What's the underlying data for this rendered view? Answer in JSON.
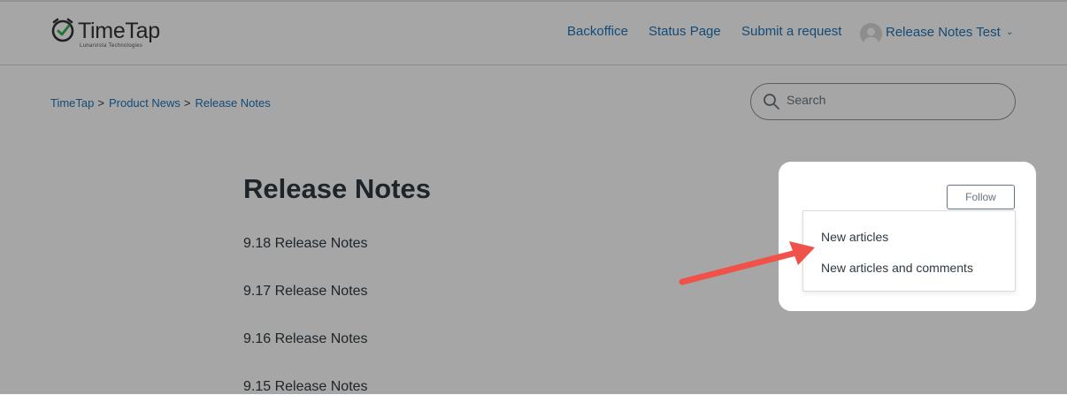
{
  "header": {
    "logo_text": "TimeTap",
    "logo_subtext": "Lunarvista Technologies",
    "nav": [
      {
        "label": "Backoffice"
      },
      {
        "label": "Status Page"
      },
      {
        "label": "Submit a request"
      }
    ],
    "user_name": "Release Notes Test",
    "caret": "⌄"
  },
  "breadcrumb": [
    {
      "label": "TimeTap"
    },
    {
      "label": "Product News"
    },
    {
      "label": "Release Notes"
    }
  ],
  "breadcrumb_separator": ">",
  "search": {
    "placeholder": "Search"
  },
  "section": {
    "title": "Release Notes",
    "articles": [
      {
        "label": "9.18 Release Notes"
      },
      {
        "label": "9.17 Release Notes"
      },
      {
        "label": "9.16 Release Notes"
      },
      {
        "label": "9.15 Release Notes"
      }
    ]
  },
  "follow": {
    "button_label": "Follow",
    "menu": [
      {
        "label": "New articles"
      },
      {
        "label": "New articles and comments"
      }
    ]
  },
  "colors": {
    "link": "#1f73b7",
    "text": "#2f3941",
    "annotation_arrow": "#f0524a"
  },
  "icons": [
    "clock-check-logo-icon",
    "user-avatar-icon",
    "chevron-down-icon",
    "search-icon",
    "annotation-arrow-icon"
  ]
}
